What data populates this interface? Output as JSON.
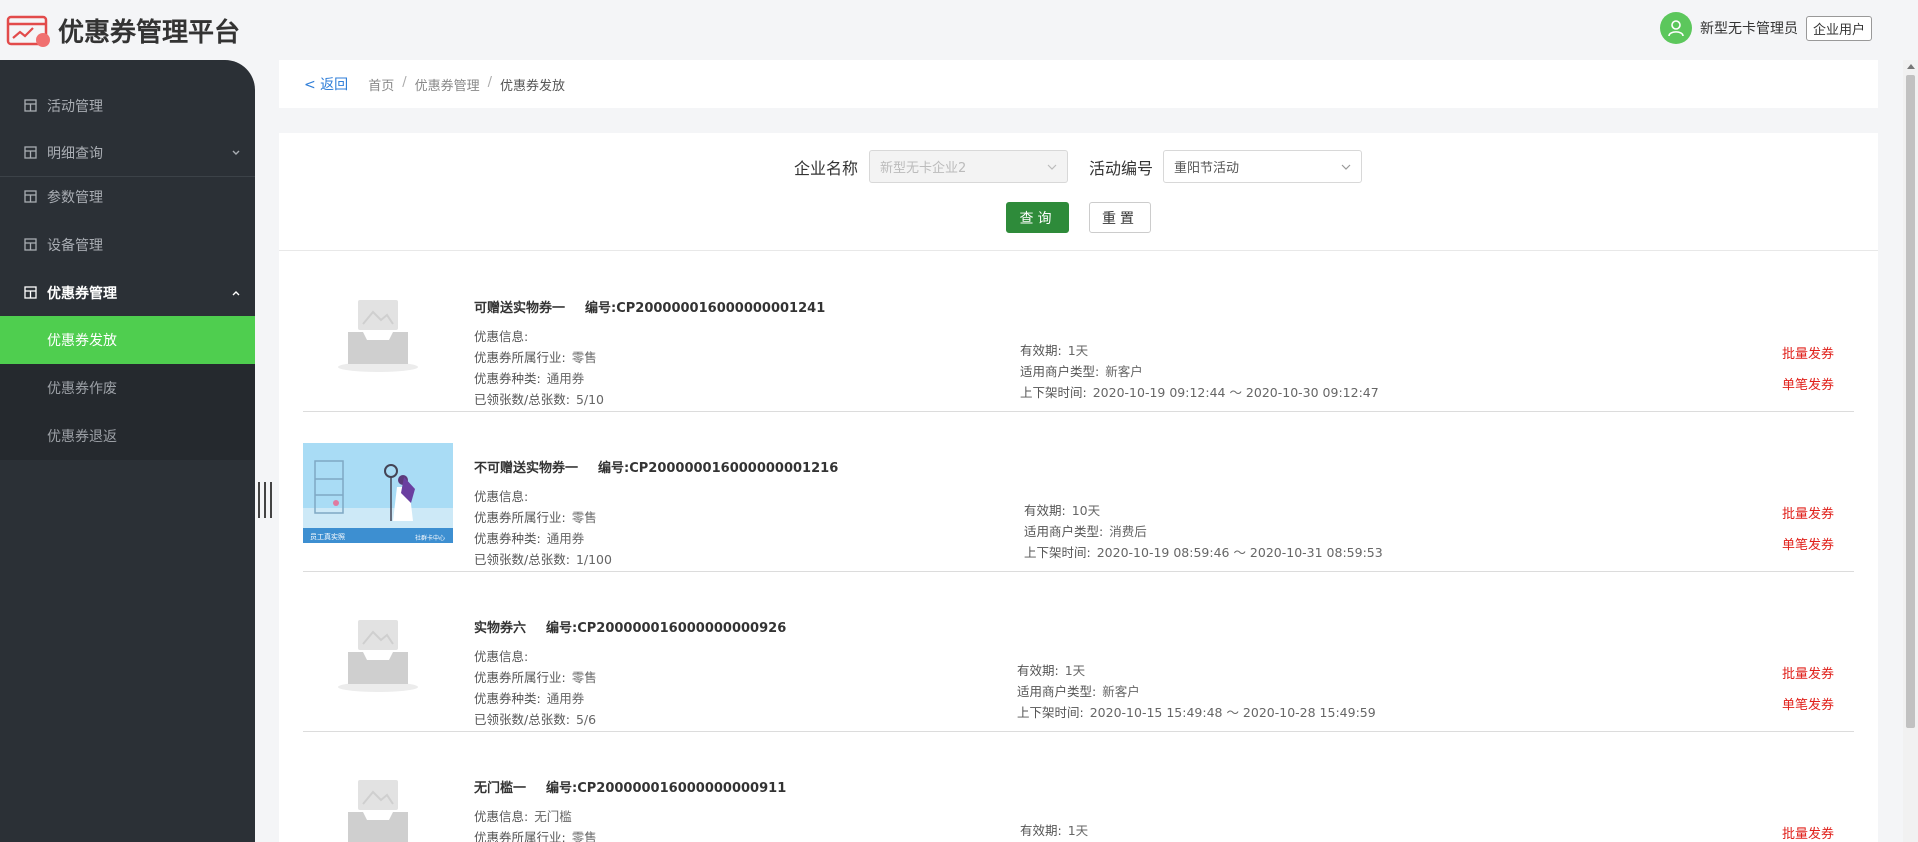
{
  "app": {
    "title": "优惠券管理平台"
  },
  "user": {
    "name": "新型无卡管理员",
    "role_badge": "企业用户"
  },
  "sidebar": {
    "items": [
      {
        "label": "活动管理"
      },
      {
        "label": "明细查询"
      },
      {
        "label": "参数管理"
      },
      {
        "label": "设备管理"
      },
      {
        "label": "优惠券管理"
      }
    ],
    "subitems": [
      {
        "label": "优惠券发放",
        "active": true
      },
      {
        "label": "优惠券作废"
      },
      {
        "label": "优惠券退返"
      }
    ]
  },
  "breadcrumb": {
    "back": "< 返回",
    "items": [
      "首页",
      "优惠券管理",
      "优惠券发放"
    ]
  },
  "filters": {
    "company_label": "企业名称",
    "company_value": "新型无卡企业2",
    "activity_label": "活动编号",
    "activity_value": "重阳节活动",
    "query_button": "查询",
    "reset_button": "重置"
  },
  "coupons": [
    {
      "name": "可赠送实物券一",
      "code": "编号:CP200000016000000001241",
      "info_label": "优惠信息:",
      "info_value": "",
      "industry_label": "优惠券所属行业:",
      "industry_value": "零售",
      "type_label": "优惠券种类:",
      "type_value": "通用券",
      "count_label": "已领张数/总张数:",
      "count_value": "5/10",
      "validity_label": "有效期:",
      "validity_value": "1天",
      "merchant_label": "适用商户类型:",
      "merchant_value": "新客户",
      "time_label": "上下架时间:",
      "time_value": "2020-10-19 09:12:44 ～ 2020-10-30 09:12:47",
      "batch_action": "批量发券",
      "single_action": "单笔发券",
      "image": "placeholder"
    },
    {
      "name": "不可赠送实物券一",
      "code": "编号:CP200000016000000001216",
      "info_label": "优惠信息:",
      "info_value": "",
      "industry_label": "优惠券所属行业:",
      "industry_value": "零售",
      "type_label": "优惠券种类:",
      "type_value": "通用券",
      "count_label": "已领张数/总张数:",
      "count_value": "1/100",
      "validity_label": "有效期:",
      "validity_value": "10天",
      "merchant_label": "适用商户类型:",
      "merchant_value": "消费后",
      "time_label": "上下架时间:",
      "time_value": "2020-10-19 08:59:46 ～ 2020-10-31 08:59:53",
      "batch_action": "批量发券",
      "single_action": "单笔发券",
      "image": "salon-illustration",
      "image_caption_left": "员工真实照",
      "image_caption_right": "社群卡中心"
    },
    {
      "name": "实物券六",
      "code": "编号:CP200000016000000000926",
      "info_label": "优惠信息:",
      "info_value": "",
      "industry_label": "优惠券所属行业:",
      "industry_value": "零售",
      "type_label": "优惠券种类:",
      "type_value": "通用券",
      "count_label": "已领张数/总张数:",
      "count_value": "5/6",
      "validity_label": "有效期:",
      "validity_value": "1天",
      "merchant_label": "适用商户类型:",
      "merchant_value": "新客户",
      "time_label": "上下架时间:",
      "time_value": "2020-10-15 15:49:48 ～ 2020-10-28 15:49:59",
      "batch_action": "批量发券",
      "single_action": "单笔发券",
      "image": "placeholder"
    },
    {
      "name": "无门槛一",
      "code": "编号:CP200000016000000000911",
      "info_label": "优惠信息:",
      "info_value": "无门槛",
      "industry_label": "优惠券所属行业:",
      "industry_value": "零售",
      "validity_label": "有效期:",
      "validity_value": "1天",
      "batch_action": "批量发券",
      "image": "placeholder"
    }
  ],
  "colors": {
    "accent_green": "#4fce4f",
    "primary_button": "#2e8b3a",
    "action_red": "#e0201a",
    "sidebar_bg": "#2b3036"
  }
}
